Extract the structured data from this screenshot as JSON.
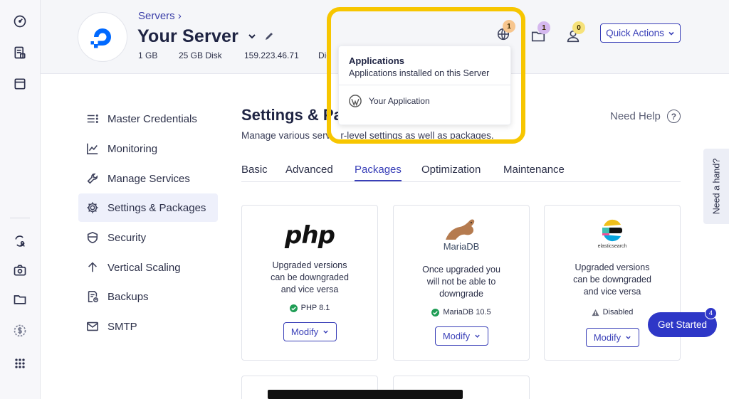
{
  "rail": {
    "icons": [
      "dashboard-gauge-icon",
      "server-list-icon",
      "browser-window-icon",
      "team-sync-icon",
      "camera-settings-icon",
      "folder-icon",
      "billing-dollar-icon",
      "apps-grid-icon"
    ]
  },
  "header": {
    "breadcrumb": "Servers ›",
    "server_name": "Your Server",
    "ram": "1 GB",
    "disk": "25 GB Disk",
    "ip": "159.223.46.71",
    "location_partial": "Dig",
    "www_badge": "1",
    "folder_badge": "1",
    "user_badge": "0",
    "quick_actions_label": "Quick Actions"
  },
  "popup": {
    "title": "Applications",
    "subtitle": "Applications installed on this Server",
    "app_name": "Your Application"
  },
  "sidebar": {
    "items": [
      {
        "label": "Master Credentials",
        "icon": "list-icon"
      },
      {
        "label": "Monitoring",
        "icon": "chart-line-icon"
      },
      {
        "label": "Manage Services",
        "icon": "wrench-icon"
      },
      {
        "label": "Settings & Packages",
        "icon": "gear-icon",
        "active": true
      },
      {
        "label": "Security",
        "icon": "shield-icon"
      },
      {
        "label": "Vertical Scaling",
        "icon": "arrow-up-icon"
      },
      {
        "label": "Backups",
        "icon": "backup-file-icon"
      },
      {
        "label": "SMTP",
        "icon": "mail-icon"
      }
    ]
  },
  "main": {
    "title_partial": "Settings & Pa",
    "subtitle_left": "Manage various serv",
    "subtitle_right": "r-level settings as well as packages.",
    "need_help": "Need Help",
    "tabs": [
      "Basic",
      "Advanced",
      "Packages",
      "Optimization",
      "Maintenance"
    ],
    "active_tab": "Packages"
  },
  "cards": [
    {
      "logo_text": "php",
      "description": "Upgraded versions\ncan be downgraded\nand vice versa",
      "status": "PHP 8.1",
      "status_kind": "ok",
      "button": "Modify"
    },
    {
      "logo_text": "MariaDB",
      "description": "Once upgraded you\nwill not be able to\ndowngrade",
      "status": "MariaDB 10.5",
      "status_kind": "ok",
      "button": "Modify"
    },
    {
      "logo_text": "elasticsearch",
      "description": "Upgraded versions\ncan be downgraded\nand vice versa",
      "status": "Disabled",
      "status_kind": "warn",
      "button": "Modify"
    }
  ],
  "floating": {
    "need_hand": "Need a hand?",
    "get_started": "Get Started",
    "get_started_badge": "4"
  },
  "colors": {
    "accent": "#3a40b8",
    "highlight": "#f7c600",
    "ok_green": "#1f9d55",
    "get_started_bg": "#2e37c7"
  }
}
